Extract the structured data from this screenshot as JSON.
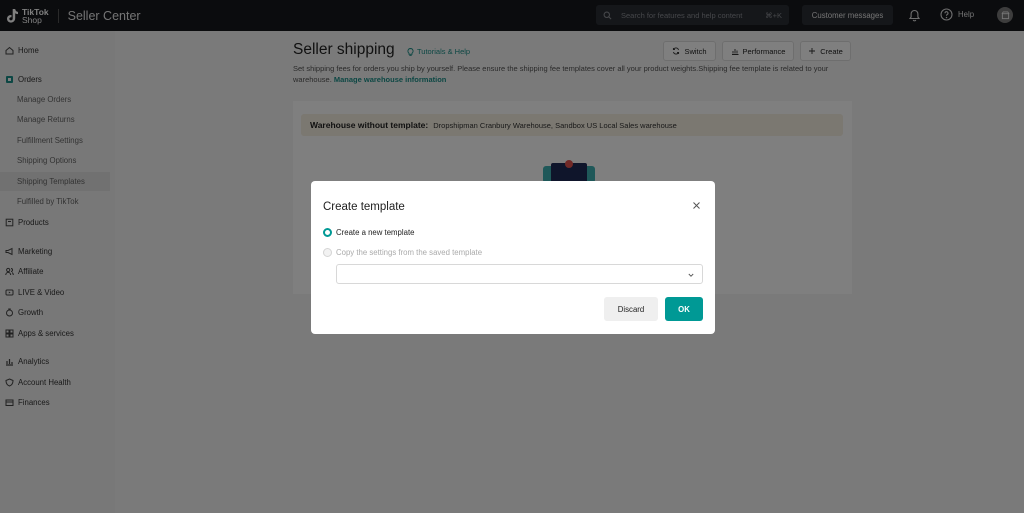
{
  "topbar": {
    "logo_line1": "TikTok",
    "logo_line2": "Shop",
    "app_name": "Seller Center",
    "search_placeholder": "Search for features and help content",
    "search_shortcut": "⌘+K",
    "customer_messages": "Customer messages",
    "help": "Help"
  },
  "sidebar": {
    "items": [
      {
        "label": "Home",
        "icon": "home-icon"
      },
      {
        "label": "Orders",
        "icon": "orders-icon"
      },
      {
        "label": "Products",
        "icon": "products-icon"
      },
      {
        "label": "Marketing",
        "icon": "marketing-icon"
      },
      {
        "label": "Affiliate",
        "icon": "affiliate-icon"
      },
      {
        "label": "LIVE & Video",
        "icon": "live-video-icon"
      },
      {
        "label": "Growth",
        "icon": "growth-icon"
      },
      {
        "label": "Apps & services",
        "icon": "apps-icon"
      },
      {
        "label": "Analytics",
        "icon": "analytics-icon"
      },
      {
        "label": "Account Health",
        "icon": "shield-icon"
      },
      {
        "label": "Finances",
        "icon": "finances-icon"
      }
    ],
    "orders_sub": [
      "Manage Orders",
      "Manage Returns",
      "Fulfillment Settings",
      "Shipping Options",
      "Shipping Templates",
      "Fulfilled by TikTok"
    ],
    "active_sub": "Shipping Templates"
  },
  "page": {
    "title": "Seller shipping",
    "tutorials": "Tutorials & Help",
    "btn_switch": "Switch",
    "btn_performance": "Performance",
    "btn_create": "Create",
    "description": "Set shipping fees for orders you ship by yourself. Please ensure the shipping fee templates cover all your product weights.Shipping fee template is related to your warehouse.",
    "manage_link": "Manage warehouse information",
    "warning_label": "Warehouse without template:",
    "warning_value": "Dropshipman Cranbury Warehouse, Sandbox US Local Sales warehouse"
  },
  "modal": {
    "title": "Create template",
    "option_new": "Create a new template",
    "option_copy": "Copy the settings from the saved template",
    "selected_option": "Create a new template",
    "select_value": "",
    "discard": "Discard",
    "ok": "OK"
  },
  "colors": {
    "accent": "#009995",
    "topbar": "#16181d"
  }
}
